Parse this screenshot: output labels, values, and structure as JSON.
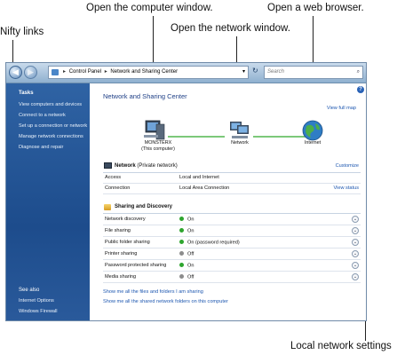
{
  "callouts": {
    "computer_window": "Open the computer window.",
    "web_browser": "Open a web browser.",
    "network_window": "Open the network window.",
    "nifty_links": "Nifty links",
    "local_settings": "Local network settings"
  },
  "toolbar": {
    "breadcrumb": [
      "Control Panel",
      "Network and Sharing Center"
    ],
    "search_placeholder": "Search"
  },
  "sidebar": {
    "tasks_header": "Tasks",
    "tasks": [
      "View computers and devices",
      "Connect to a network",
      "Set up a connection or network",
      "Manage network connections",
      "Diagnose and repair"
    ],
    "see_also_header": "See also",
    "see_also": [
      "Internet Options",
      "Windows Firewall"
    ]
  },
  "main": {
    "title": "Network and Sharing Center",
    "view_full_map": "View full map",
    "map": {
      "computer_name": "MONSTERX",
      "computer_sub": "(This computer)",
      "network": "Network",
      "internet": "Internet"
    },
    "network_section": {
      "name": "Network",
      "type": "(Private network)",
      "customize": "Customize",
      "rows": [
        {
          "label": "Access",
          "value": "Local and Internet",
          "action": ""
        },
        {
          "label": "Connection",
          "value": "Local Area Connection",
          "action": "View status"
        }
      ]
    },
    "sharing": {
      "header": "Sharing and Discovery",
      "rows": [
        {
          "label": "Network discovery",
          "state": "On",
          "color": "#2ea52e"
        },
        {
          "label": "File sharing",
          "state": "On",
          "color": "#2ea52e"
        },
        {
          "label": "Public folder sharing",
          "state": "On (password required)",
          "color": "#2ea52e"
        },
        {
          "label": "Printer sharing",
          "state": "Off",
          "color": "#8c8c8c"
        },
        {
          "label": "Password protected sharing",
          "state": "On",
          "color": "#2ea52e"
        },
        {
          "label": "Media sharing",
          "state": "Off",
          "color": "#8c8c8c"
        }
      ]
    },
    "bottom_links": [
      "Show me all the files and folders I am sharing",
      "Show me all the shared network folders on this computer"
    ]
  }
}
